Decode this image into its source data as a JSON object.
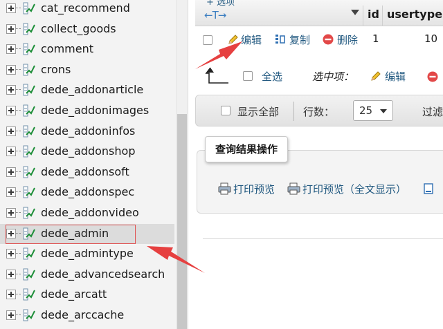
{
  "nav": {
    "items": [
      {
        "label": "cat_recommend"
      },
      {
        "label": "collect_goods"
      },
      {
        "label": "comment"
      },
      {
        "label": "crons"
      },
      {
        "label": "dede_addonarticle"
      },
      {
        "label": "dede_addonimages"
      },
      {
        "label": "dede_addoninfos"
      },
      {
        "label": "dede_addonshop"
      },
      {
        "label": "dede_addonsoft"
      },
      {
        "label": "dede_addonspec"
      },
      {
        "label": "dede_addonvideo"
      },
      {
        "label": "dede_admin",
        "selected": true
      },
      {
        "label": "dede_admintype"
      },
      {
        "label": "dede_advancedsearch"
      },
      {
        "label": "dede_arcatt"
      },
      {
        "label": "dede_arccache"
      }
    ]
  },
  "results": {
    "options_link": "+ 选项",
    "columns": [
      "id",
      "usertype"
    ],
    "row": {
      "edit": "编辑",
      "copy": "复制",
      "delete": "删除",
      "id": "1",
      "usertype": "10"
    },
    "bulk": {
      "select_all": "全选",
      "with_selected": "选中项：",
      "edit": "编辑"
    },
    "navigation": {
      "show_all": "显示全部",
      "rows_label": "行数：",
      "rows_value": "25",
      "filter_label": "过滤"
    },
    "operations": {
      "legend": "查询结果操作",
      "print": "打印预览",
      "print_full": "打印预览（全文显示）"
    }
  },
  "colors": {
    "annotation": "#e64040",
    "link": "#235a81",
    "selected_row": "#dcdcdc"
  }
}
